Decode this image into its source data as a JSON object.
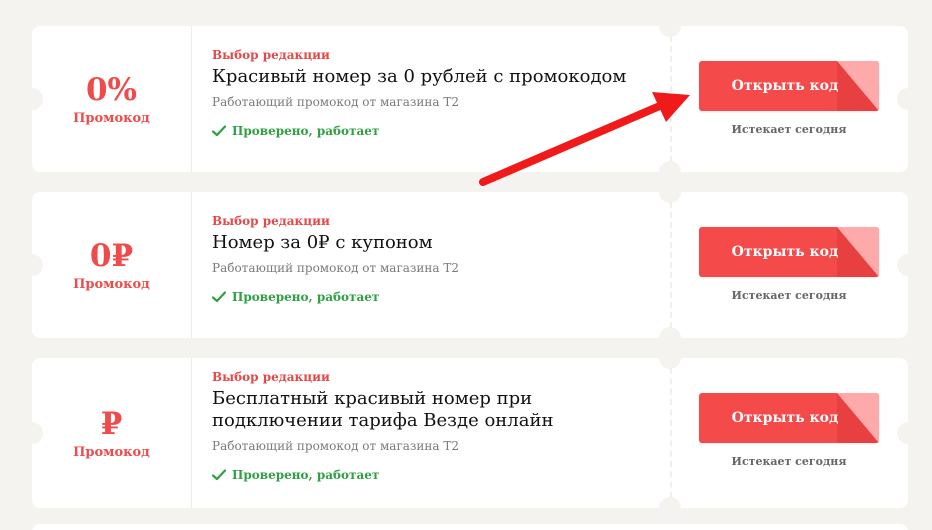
{
  "colors": {
    "accent": "#f44a4a",
    "accent_fold": "#ffaaaa",
    "verified": "#2ea043",
    "background": "#f5f3ef"
  },
  "coupons": [
    {
      "discount": "0%",
      "discount_label": "Промокод",
      "editor_label": "Выбор редакции",
      "title": "Красивый номер за 0 рублей с промокодом",
      "subtitle": "Работающий промокод от магазина Т2",
      "verified": "Проверено, работает",
      "button": "Открыть код",
      "expires": "Истекает сегодня"
    },
    {
      "discount": "0₽",
      "discount_label": "Промокод",
      "editor_label": "Выбор редакции",
      "title": "Номер за 0₽ с купоном",
      "subtitle": "Работающий промокод от магазина Т2",
      "verified": "Проверено, работает",
      "button": "Открыть код",
      "expires": "Истекает сегодня"
    },
    {
      "discount": "₽",
      "discount_label": "Промокод",
      "editor_label": "Выбор редакции",
      "title": "Бесплатный красивый номер при подключении тарифа Везде онлайн",
      "subtitle": "Работающий промокод от магазина Т2",
      "verified": "Проверено, работает",
      "button": "Открыть код",
      "expires": "Истекает сегодня"
    }
  ],
  "icons": {
    "check": "check-icon",
    "arrow": "red-arrow-annotation"
  }
}
